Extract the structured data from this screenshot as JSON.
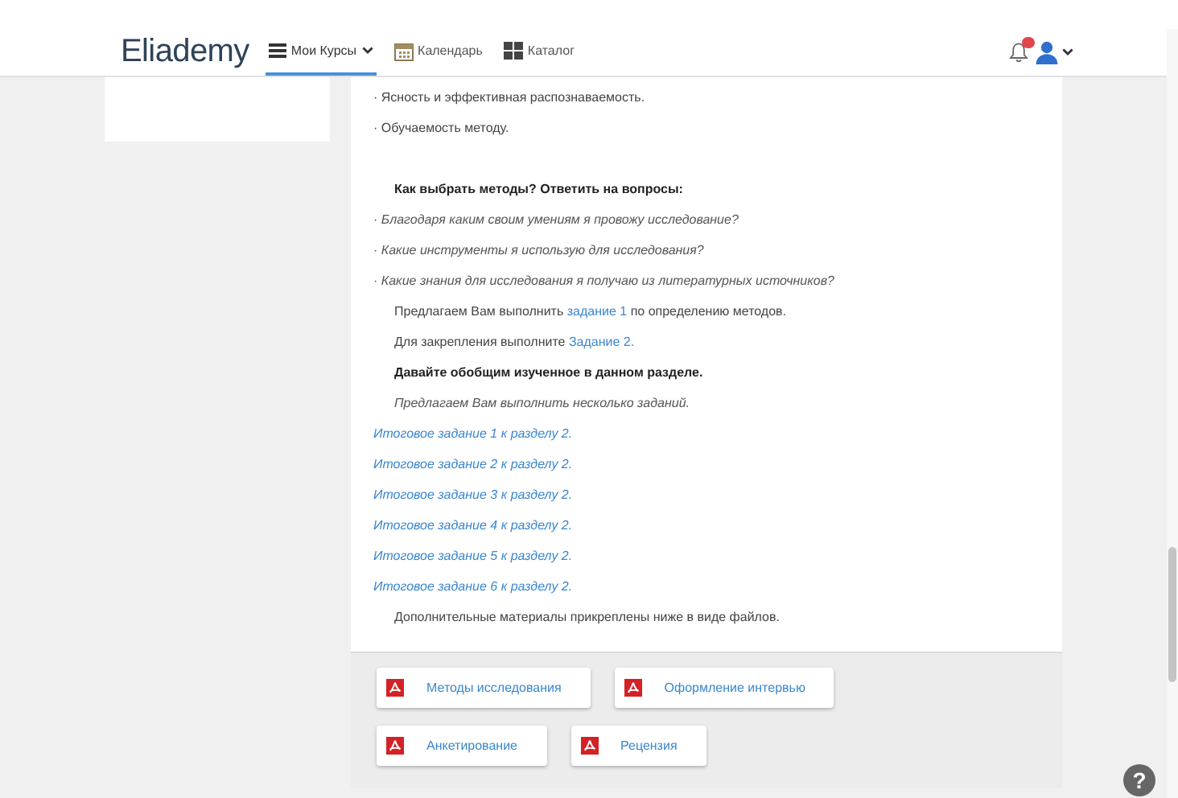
{
  "header": {
    "logo": "Eliademy",
    "nav": [
      {
        "label": "Мои Курсы",
        "dropdown": true,
        "selected": true
      },
      {
        "label": "Календарь",
        "dropdown": false,
        "selected": false
      },
      {
        "label": "Каталог",
        "dropdown": false,
        "selected": false
      }
    ],
    "notifications": {
      "unread": true
    },
    "account": {
      "dropdown": true
    }
  },
  "content": {
    "lines": [
      {
        "kind": "plain",
        "indent": false,
        "parts": [
          {
            "text": "· Ясность и эффективная распознаваемость.",
            "link": false
          }
        ]
      },
      {
        "kind": "plain",
        "indent": false,
        "parts": [
          {
            "text": "· Обучаемость методу.",
            "link": false
          }
        ]
      },
      {
        "kind": "blank"
      },
      {
        "kind": "bold",
        "indent": true,
        "parts": [
          {
            "text": "Как выбрать методы? Ответить на вопросы:",
            "link": false
          }
        ]
      },
      {
        "kind": "italic",
        "indent": false,
        "parts": [
          {
            "text": "· Благодаря каким своим умениям я провожу исследование?",
            "link": false
          }
        ]
      },
      {
        "kind": "italic",
        "indent": false,
        "parts": [
          {
            "text": "· Какие инструменты я использую для исследования?",
            "link": false
          }
        ]
      },
      {
        "kind": "italic",
        "indent": false,
        "parts": [
          {
            "text": "· Какие знания для исследования я получаю из литературных источников?",
            "link": false
          }
        ]
      },
      {
        "kind": "plain",
        "indent": true,
        "parts": [
          {
            "text": "Предлагаем Вам выполнить ",
            "link": false
          },
          {
            "text": "задание 1",
            "link": true
          },
          {
            "text": " по определению методов.",
            "link": false
          }
        ]
      },
      {
        "kind": "plain",
        "indent": true,
        "parts": [
          {
            "text": "Для закрепления выполните ",
            "link": false
          },
          {
            "text": "Задание 2.",
            "link": true
          }
        ]
      },
      {
        "kind": "bold",
        "indent": true,
        "parts": [
          {
            "text": "Давайте обобщим изученное в данном разделе.",
            "link": false
          }
        ]
      },
      {
        "kind": "italic",
        "indent": true,
        "parts": [
          {
            "text": "Предлагаем Вам выполнить несколько заданий.",
            "link": false
          }
        ]
      },
      {
        "kind": "italic",
        "indent": false,
        "parts": [
          {
            "text": "Итоговое задание 1 к разделу 2.",
            "link": true
          }
        ]
      },
      {
        "kind": "italic",
        "indent": false,
        "parts": [
          {
            "text": "Итоговое задание 2 к разделу 2.",
            "link": true
          }
        ]
      },
      {
        "kind": "italic",
        "indent": false,
        "parts": [
          {
            "text": "Итоговое задание 3 к разделу 2.",
            "link": true
          }
        ]
      },
      {
        "kind": "italic",
        "indent": false,
        "parts": [
          {
            "text": "Итоговое задание 4 к разделу 2.",
            "link": true
          }
        ]
      },
      {
        "kind": "italic",
        "indent": false,
        "parts": [
          {
            "text": "Итоговое задание 5 к разделу 2.",
            "link": true
          }
        ]
      },
      {
        "kind": "italic",
        "indent": false,
        "parts": [
          {
            "text": "Итоговое задание 6 к разделу 2.",
            "link": true
          }
        ]
      },
      {
        "kind": "plain",
        "indent": true,
        "parts": [
          {
            "text": "Дополнительные материалы прикреплены ниже в виде файлов.",
            "link": false
          }
        ]
      }
    ]
  },
  "attachments": [
    [
      {
        "name": "Методы исследования"
      },
      {
        "name": "Оформление интервью"
      }
    ],
    [
      {
        "name": "Анкетирование"
      },
      {
        "name": "Рецензия"
      }
    ]
  ],
  "help": {
    "label": "?"
  }
}
